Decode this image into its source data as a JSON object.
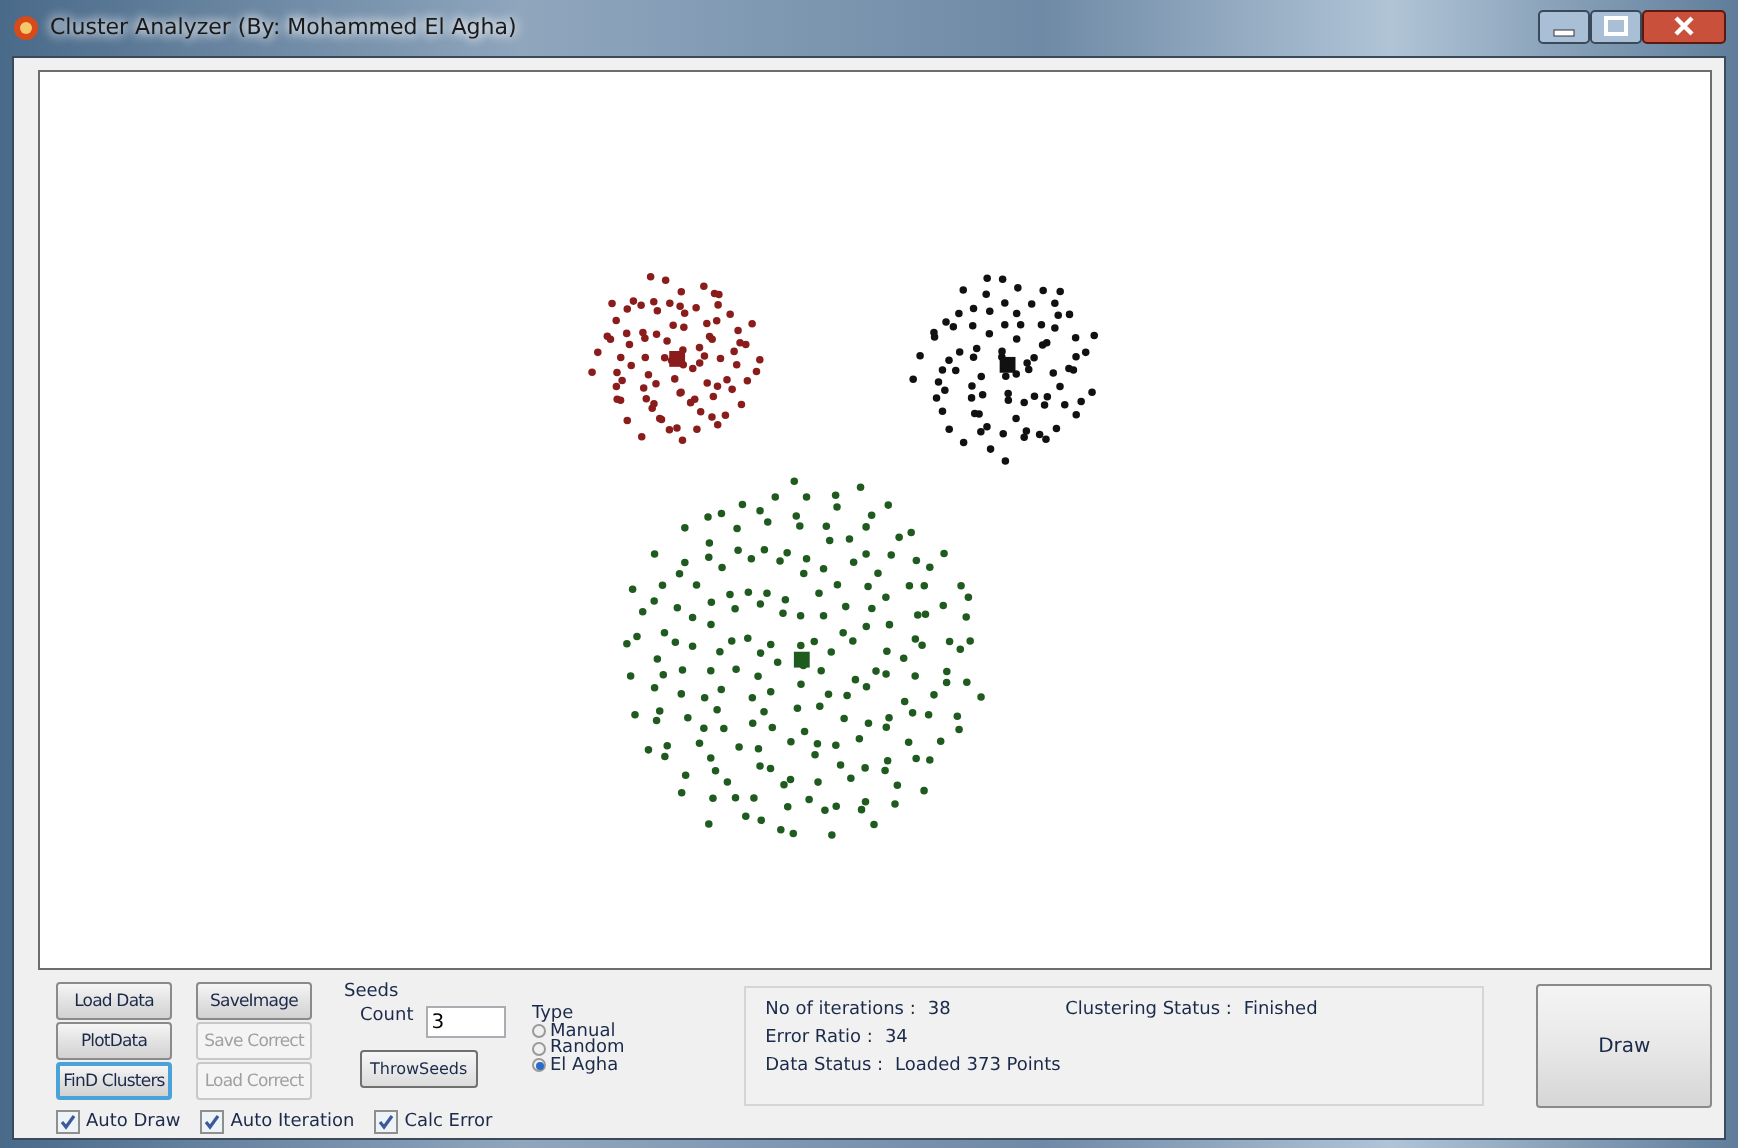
{
  "window": {
    "title": "Cluster Analyzer (By: Mohammed El Agha)"
  },
  "plot": {
    "clusters": [
      {
        "color": "#8b1c1c"
      },
      {
        "color": "#111111"
      },
      {
        "color": "#1f5a1f"
      }
    ]
  },
  "buttons": [
    {
      "label": "Load Data",
      "disabled": false,
      "focused": false
    },
    {
      "label": "PlotData",
      "disabled": false,
      "focused": false
    },
    {
      "label": "FinD Clusters",
      "disabled": false,
      "focused": true
    },
    {
      "label": "SaveImage",
      "disabled": false,
      "focused": false
    },
    {
      "label": "Save Correct",
      "disabled": true,
      "focused": false
    },
    {
      "label": "Load Correct",
      "disabled": true,
      "focused": false
    }
  ],
  "checkboxes": [
    {
      "label": "Auto Draw",
      "checked": true
    },
    {
      "label": "Auto Iteration",
      "checked": true
    },
    {
      "label": "Calc Error",
      "checked": true
    }
  ],
  "seeds": {
    "title": "Seeds",
    "count_label": "Count",
    "count": "3",
    "button": "ThrowSeeds"
  },
  "type": {
    "title": "Type",
    "options": [
      {
        "label": "Manual",
        "selected": false
      },
      {
        "label": "Random",
        "selected": false
      },
      {
        "label": "El Agha",
        "selected": true
      }
    ]
  },
  "status": {
    "left": [
      {
        "label": "No of iterations :",
        "value": "38"
      },
      {
        "label": "Error Ratio :",
        "value": "34"
      },
      {
        "label": "Data Status :",
        "value": "Loaded 373 Points"
      }
    ],
    "right": [
      {
        "label": "Clustering Status :",
        "value": "Finished"
      }
    ]
  },
  "draw_button": "Draw"
}
